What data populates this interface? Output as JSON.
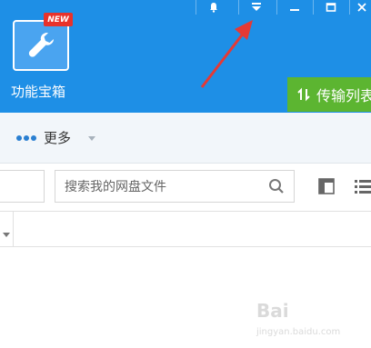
{
  "window_controls": {
    "items": [
      "bell-icon",
      "dropdown-menu-icon",
      "minimize-icon",
      "maximize-icon",
      "close-icon"
    ]
  },
  "header": {
    "tool_box_label": "功能宝箱",
    "new_badge": "NEW",
    "transfer_label": "传输列表",
    "accent_color": "#1e8fe6",
    "transfer_color": "#5cb531",
    "badge_color": "#e8322b"
  },
  "toolbar": {
    "more_label": "更多"
  },
  "search": {
    "placeholder": "搜索我的网盘文件"
  },
  "annotation": {
    "arrow_color": "#e53935"
  },
  "watermark": {
    "text": "Bai",
    "sub": "jingyan.baidu.com"
  }
}
